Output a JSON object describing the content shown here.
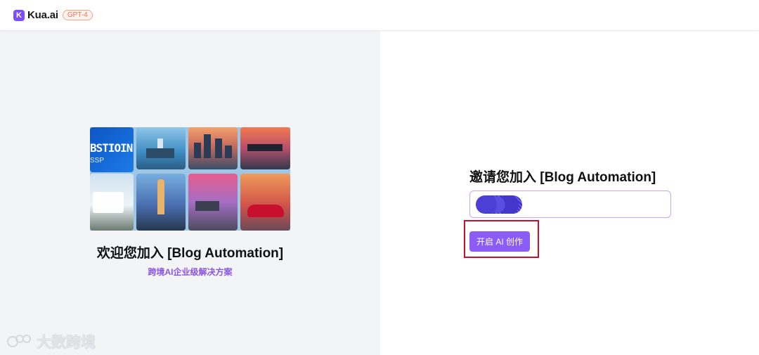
{
  "header": {
    "logo_mark": "K",
    "logo_text": "Kua.ai",
    "model_badge": "GPT-4"
  },
  "left": {
    "collage_captions": {
      "tile1_big": "BSTIOIN",
      "tile1_small": "SSP"
    },
    "welcome_title": "欢迎您加入 [Blog Automation]",
    "subtitle": "跨境AI企业级解决方案",
    "watermark_text": "大数跨境"
  },
  "right": {
    "invite_title": "邀请您加入 [Blog Automation]",
    "name_input": {
      "value": "",
      "placeholder": ""
    },
    "start_button_label": "开启 AI 创作"
  },
  "colors": {
    "brand": "#7c4dff",
    "button": "#8b5cf6",
    "subtitle": "#8a55e6",
    "highlight_box": "#c8102e",
    "left_panel_bg": "#f3f4f6"
  }
}
